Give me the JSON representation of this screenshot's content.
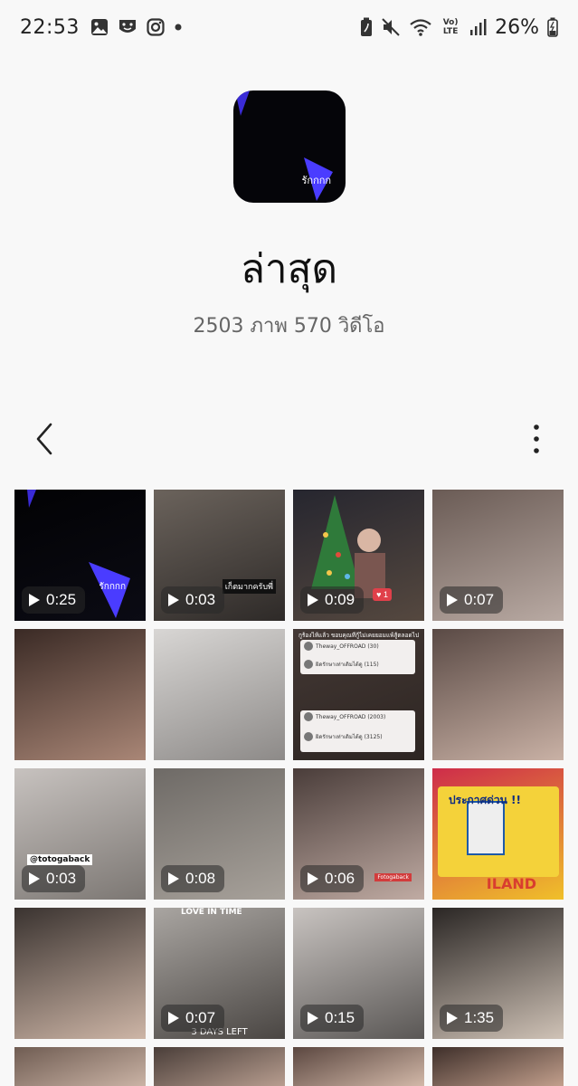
{
  "status_bar": {
    "time": "22:53",
    "battery_percent": "26%",
    "volte_label": "Vo) LTE",
    "left_icons": [
      "gallery-icon",
      "theater-icon",
      "instagram-icon",
      "dot-icon"
    ],
    "right_icons": [
      "battery-saver-icon",
      "mute-icon",
      "wifi-icon",
      "volte-icon",
      "signal-icon",
      "battery-icon"
    ]
  },
  "album": {
    "thumb_caption": "รักกกก",
    "title": "ล่าสุด",
    "count": "2503 ภาพ 570 วิดีโอ"
  },
  "toolbar": {
    "back_icon": "chevron-left-icon",
    "more_icon": "more-vertical-icon"
  },
  "grid": {
    "tiles": [
      {
        "kind": "video",
        "duration": "0:25",
        "overlay": "รักกกก",
        "colors": [
          "#020204",
          "#0b0b14"
        ]
      },
      {
        "kind": "video",
        "duration": "0:03",
        "overlay": "เก็ตมากครับพี่",
        "colors": [
          "#6b635c",
          "#2e2a28"
        ]
      },
      {
        "kind": "video",
        "duration": "0:09",
        "like_count": "1",
        "colors": [
          "#26262f",
          "#55483f"
        ]
      },
      {
        "kind": "video",
        "duration": "0:07",
        "colors": [
          "#6a5b55",
          "#b9aaa3"
        ]
      },
      {
        "kind": "photo",
        "colors": [
          "#3a2a25",
          "#a98676"
        ]
      },
      {
        "kind": "photo",
        "colors": [
          "#d8d6d4",
          "#8d8a88"
        ]
      },
      {
        "kind": "photo",
        "header": "กูร้องไห้แล้ว ขอบคุณทีกู้ไม่เคยยอมแพ้สู้ตลอดไป",
        "entries": [
          {
            "name": "Theway_OFFROAD (30)"
          },
          {
            "name": "ผิดรักษาเท่าเดิมได้ดู (115)"
          },
          {
            "name": "Theway_OFFROAD (2003)"
          },
          {
            "name": "ผิดรักษาเท่าเดิมได้ดู (3125)"
          }
        ],
        "colors": [
          "#433834",
          "#2d2522"
        ]
      },
      {
        "kind": "photo",
        "colors": [
          "#5a4a45",
          "#c9b1a5"
        ]
      },
      {
        "kind": "video",
        "duration": "0:03",
        "overlay": "@totogaback",
        "colors": [
          "#c7c2bf",
          "#7c7773"
        ]
      },
      {
        "kind": "video",
        "duration": "0:08",
        "colors": [
          "#6e6a66",
          "#a8a29b"
        ]
      },
      {
        "kind": "video",
        "duration": "0:06",
        "overlay": "Fotogaback",
        "colors": [
          "#4a3d3a",
          "#c0aba3"
        ]
      },
      {
        "kind": "photo",
        "header": "ประกาศด่วน !!",
        "overlay": "ILAND",
        "colors": [
          "#ce2c4a",
          "#f0c02a"
        ]
      },
      {
        "kind": "photo",
        "colors": [
          "#3a3330",
          "#cdb5a6"
        ]
      },
      {
        "kind": "video",
        "duration": "0:07",
        "overlay": "3 DAYS LEFT",
        "header": "LOVE IN TIME",
        "colors": [
          "#a9a5a1",
          "#4a4643"
        ]
      },
      {
        "kind": "video",
        "duration": "0:15",
        "colors": [
          "#c8c3c0",
          "#5a5755"
        ]
      },
      {
        "kind": "video",
        "duration": "1:35",
        "colors": [
          "#2a2624",
          "#cfc2b6"
        ]
      },
      {
        "kind": "photo",
        "colors": [
          "#6f5c52",
          "#cab3a5"
        ]
      },
      {
        "kind": "photo",
        "colors": [
          "#4a3e39",
          "#b79d8f"
        ]
      },
      {
        "kind": "photo",
        "colors": [
          "#5b4740",
          "#d2b8a8"
        ]
      },
      {
        "kind": "photo",
        "colors": [
          "#3e2f2a",
          "#c29f8c"
        ]
      }
    ]
  }
}
